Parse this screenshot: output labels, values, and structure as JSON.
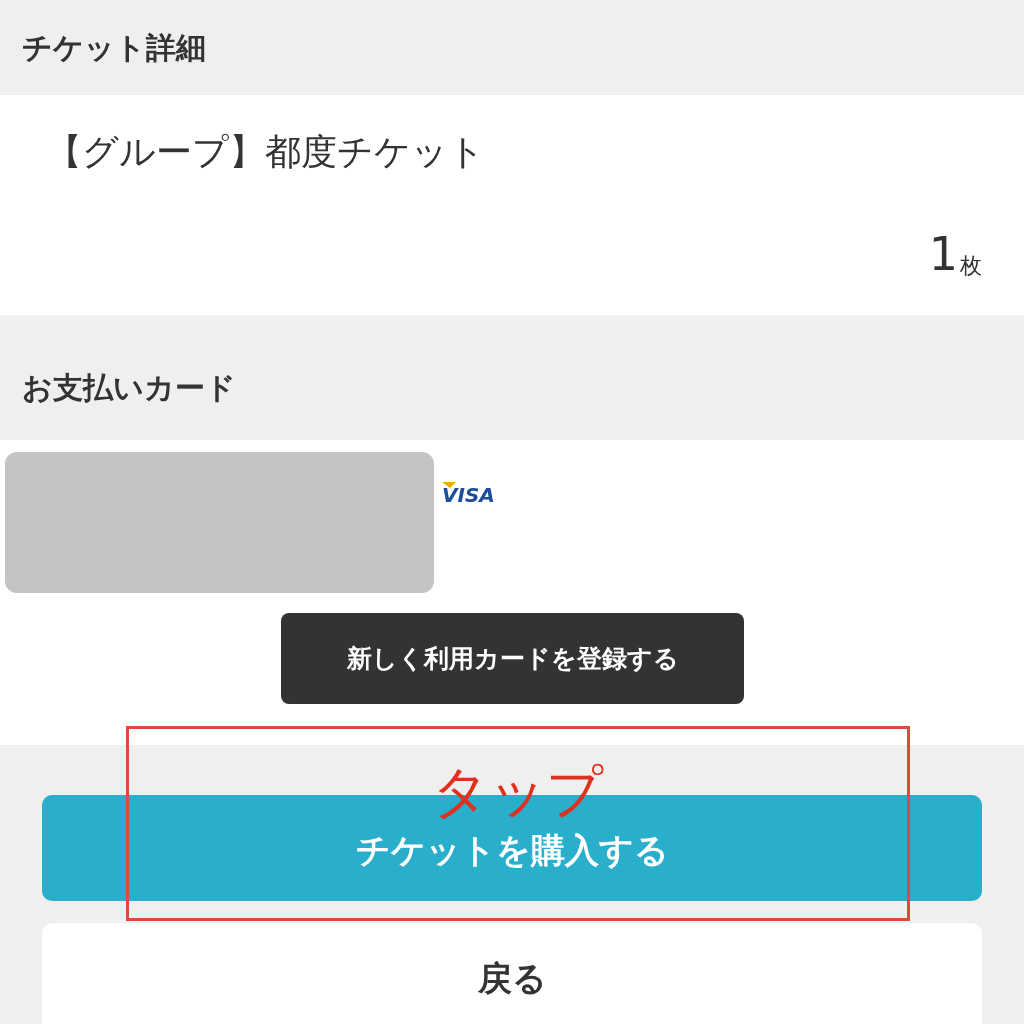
{
  "ticket_section": {
    "title": "チケット詳細",
    "ticket_name": "【グループ】都度チケット",
    "quantity": "1",
    "quantity_unit": "枚"
  },
  "payment_section": {
    "title": "お支払いカード",
    "card": {
      "brand": "VISA"
    },
    "register_button": "新しく利用カードを登録する"
  },
  "purchase_button": "チケットを購入する",
  "annotation": {
    "label": "タップ"
  },
  "back_button": "戻る"
}
